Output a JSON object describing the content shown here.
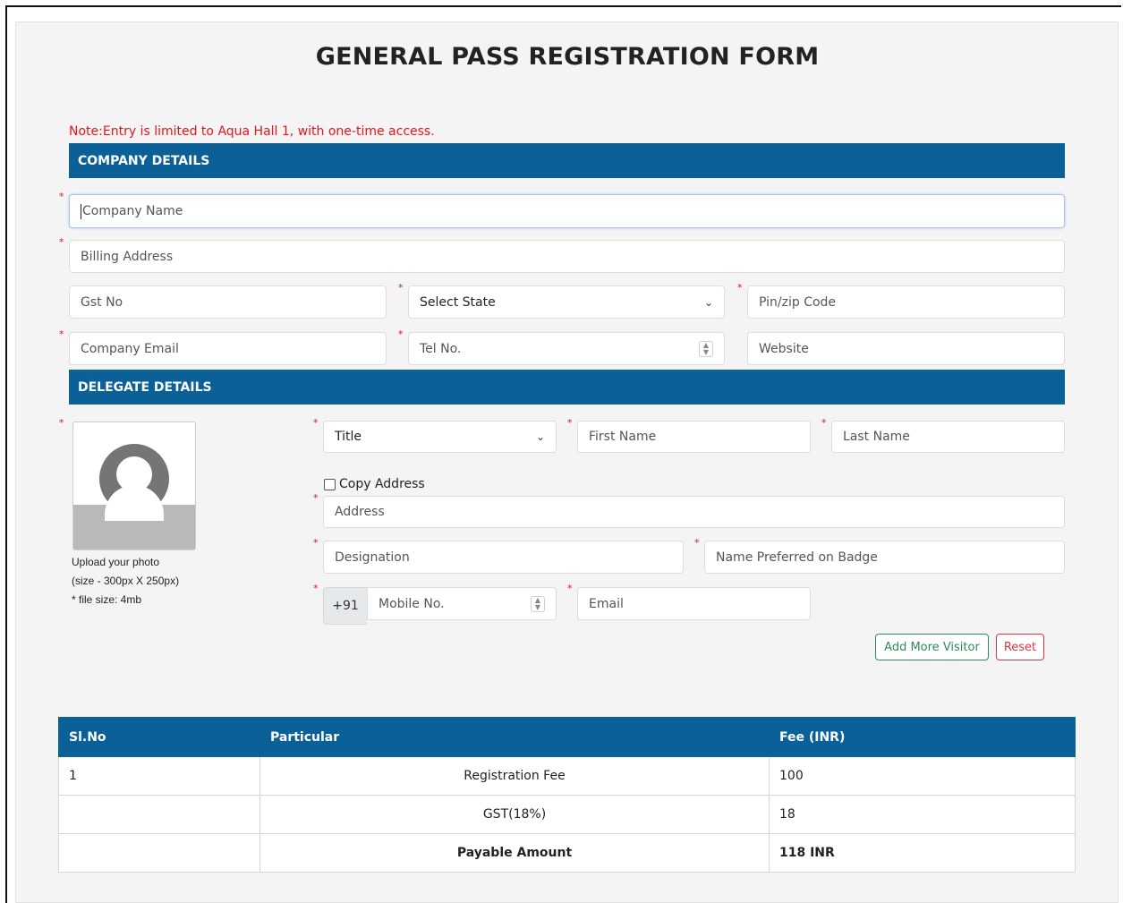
{
  "title": "GENERAL PASS REGISTRATION FORM",
  "note": "Note:Entry is limited to Aqua Hall 1, with one-time access.",
  "company_section": {
    "heading": "COMPANY DETAILS",
    "company_name": "Company Name",
    "billing_address": "Billing Address",
    "gst_no": "Gst No",
    "state_select": "Select State",
    "pin_code": "Pin/zip Code",
    "company_email": "Company Email",
    "tel_no": "Tel No.",
    "website": "Website"
  },
  "delegate_section": {
    "heading": "DELEGATE DETAILS",
    "title_select": "Title",
    "first_name": "First Name",
    "last_name": "Last Name",
    "copy_address": "Copy Address",
    "address": "Address",
    "designation": "Designation",
    "badge_name": "Name Preferred on Badge",
    "mobile_prefix": "+91",
    "mobile_no": "Mobile No.",
    "email": "Email",
    "photo_note_1": "Upload your photo",
    "photo_note_2": "(size - 300px X 250px)",
    "photo_note_3": "* file size: 4mb",
    "add_visitor_button": "Add More Visitor",
    "reset_button": "Reset"
  },
  "required_mark": "*",
  "icons": {
    "chevron": "chevron-down-icon",
    "spinner": "number-spinner-icon",
    "avatar": "user-avatar-icon"
  },
  "colors": {
    "header_blue": "#0a6097",
    "required_red": "#e8151b",
    "add_green": "#2e8b57",
    "reset_red": "#dc3545"
  },
  "fee_table": {
    "headers": [
      "Sl.No",
      "Particular",
      "Fee (INR)"
    ],
    "rows": [
      [
        "1",
        "Registration Fee",
        "100"
      ],
      [
        "",
        "GST(18%)",
        "18"
      ],
      [
        "",
        "Payable Amount",
        "118 INR"
      ]
    ]
  }
}
